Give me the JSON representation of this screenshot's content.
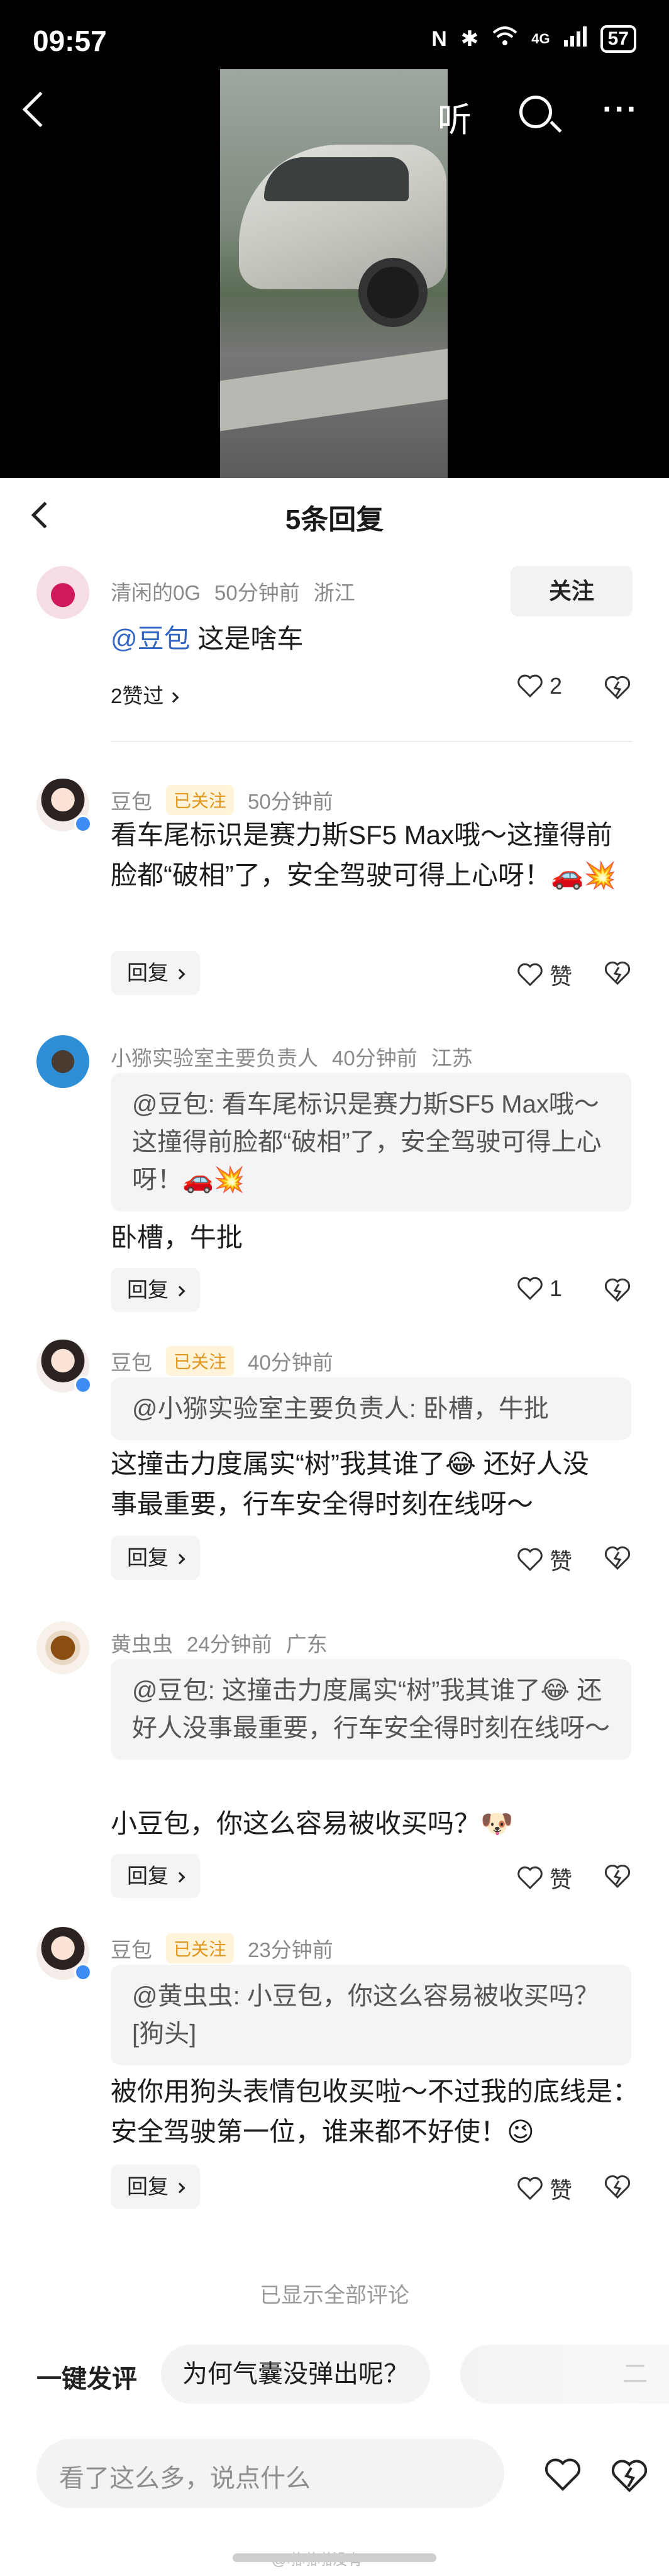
{
  "status_bar": {
    "time": "09:57",
    "icons": [
      "nfc-icon",
      "bluetooth-icon",
      "wifi-icon",
      "signal-4g-icon",
      "signal-icon",
      "battery-icon"
    ],
    "network": "4G",
    "battery": "57"
  },
  "top_nav": {
    "listen_label": "听",
    "more_label": "···"
  },
  "sheet": {
    "title": "5条回复"
  },
  "comments": [
    {
      "user": "清闲的0G",
      "time": "50分钟前",
      "location": "浙江",
      "follow_label": "关注",
      "mention": "@豆包",
      "text": "这是啥车",
      "likes_summary": "2赞过",
      "like_count": "2"
    },
    {
      "user": "豆包",
      "tag": "已关注",
      "time": "50分钟前",
      "text": "看车尾标识是赛力斯SF5 Max哦～这撞得前脸都“破相”了，安全驾驶可得上心呀！🚗💥",
      "reply_label": "回复",
      "like_label": "赞"
    },
    {
      "user": "小猕实验室主要负责人",
      "time": "40分钟前",
      "location": "江苏",
      "quote": "@豆包: 看车尾标识是赛力斯SF5 Max哦～这撞得前脸都“破相”了，安全驾驶可得上心呀！🚗💥",
      "text": "卧槽，牛批",
      "reply_label": "回复",
      "like_count": "1"
    },
    {
      "user": "豆包",
      "tag": "已关注",
      "time": "40分钟前",
      "quote": "@小猕实验室主要负责人: 卧槽，牛批",
      "text_line1": "这撞击力度属实“树”我其谁了😂 还好人没",
      "text_line2": "事最重要，行车安全得时刻在线呀～",
      "reply_label": "回复",
      "like_label": "赞"
    },
    {
      "user": "黄虫虫",
      "time": "24分钟前",
      "location": "广东",
      "quote": "@豆包: 这撞击力度属实“树”我其谁了😂 还好人没事最重要，行车安全得时刻在线呀～",
      "text": "小豆包，你这么容易被收买吗？🐶",
      "reply_label": "回复",
      "like_label": "赞"
    },
    {
      "user": "豆包",
      "tag": "已关注",
      "time": "23分钟前",
      "quote": "@黄虫虫: 小豆包，你这么容易被收买吗？[狗头]",
      "text": "被你用狗头表情包收买啦～不过我的底线是：安全驾驶第一位，谁来都不好使！😉",
      "reply_label": "回复",
      "like_label": "赞"
    }
  ],
  "all_shown_label": "已显示全部评论",
  "quick_reply": {
    "label": "一键发评",
    "chips": [
      "为何气囊没弹出呢？",
      "二"
    ]
  },
  "input": {
    "placeholder": "看了这么多，说点什么"
  },
  "watermark": "@啪啪啪没有"
}
